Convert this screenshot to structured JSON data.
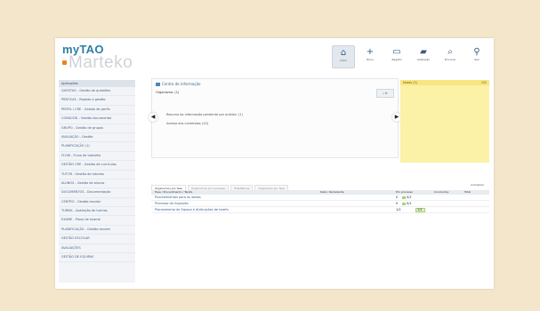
{
  "app": {
    "logo_top": "myTAO",
    "logo_bottom": "Marteko"
  },
  "toolbar": {
    "items": [
      {
        "icon": "home-icon",
        "glyph": "⌂",
        "label": "Início",
        "active": true
      },
      {
        "icon": "plus-icon",
        "glyph": "+",
        "label": "Novo",
        "active": false
      },
      {
        "icon": "register-icon",
        "glyph": "▭",
        "label": "Registo",
        "active": false
      },
      {
        "icon": "camera-icon",
        "glyph": "▰",
        "label": "Avaliação",
        "active": false
      },
      {
        "icon": "search-icon",
        "glyph": "⌕",
        "label": "Procurar",
        "active": false
      },
      {
        "icon": "pin-icon",
        "glyph": "⚲",
        "label": "Sair",
        "active": false
      }
    ]
  },
  "sidebar": {
    "header": "Aplicações",
    "items": [
      "QUESTAO - Gestão de questões",
      "PRÁTICAS - Registo e gestão",
      "PERFIL / CRE - Gestão de perfis",
      "CONSULTA - Gestão documental",
      "GRUPO - Gestão de grupos",
      "AVALIAÇÃO - Gestão",
      "PLANIFICAÇÃO (1)",
      "FLOW - Fluxo de trabalho",
      "GESTÃO CRE - Gestão de currículos",
      "TUTOR - Gestão de tutorias",
      "ALUNOS - Gestão de alunos",
      "DOCUMENTOS - Documentação",
      "CENTRO - Gestão escolar",
      "TURMA - Avaliação de turmas",
      "EXAME - Plano de exame",
      "PLANIFICAÇÃO - Gestão escolar",
      "GESTÃO ESCOLAR",
      "AVALIAÇÕES",
      "GESTÃO DE EQUIPAS"
    ]
  },
  "panel": {
    "title": "Centro de informação",
    "search_label": "Organismo: (1)",
    "search_button": "Ir",
    "line1": "Resumo da informação pendente por análise: (1)",
    "line2": "Acesso aos conteúdos (10)"
  },
  "sticky": {
    "title": "Notas (1)",
    "count": "0/2"
  },
  "table": {
    "tabs": [
      "Organismos por fase",
      "Organismos por processo",
      "Estatísticas",
      "Organismo por fase"
    ],
    "button": "Actualizar",
    "headers": {
      "name": "Fase / Procedimento / Tarefa",
      "ref": "Data / Remetente",
      "prog": "Em processo",
      "done": "Concluídos",
      "total": "Total"
    },
    "rows": [
      {
        "title": "Procedimentos para os dados",
        "a": "0",
        "b": "0/1"
      },
      {
        "title": "Processo de Inspeção",
        "a": "0",
        "b": "0/1"
      },
      {
        "title": "Planeamento de Equipa e Atribuições de tarefa",
        "a": "1/2",
        "b": "1/1"
      }
    ]
  },
  "colors": {
    "background": "#f3e6cb",
    "accent": "#2c7fa6",
    "sticky": "#fbf2a7",
    "progress": "#a9d279"
  }
}
